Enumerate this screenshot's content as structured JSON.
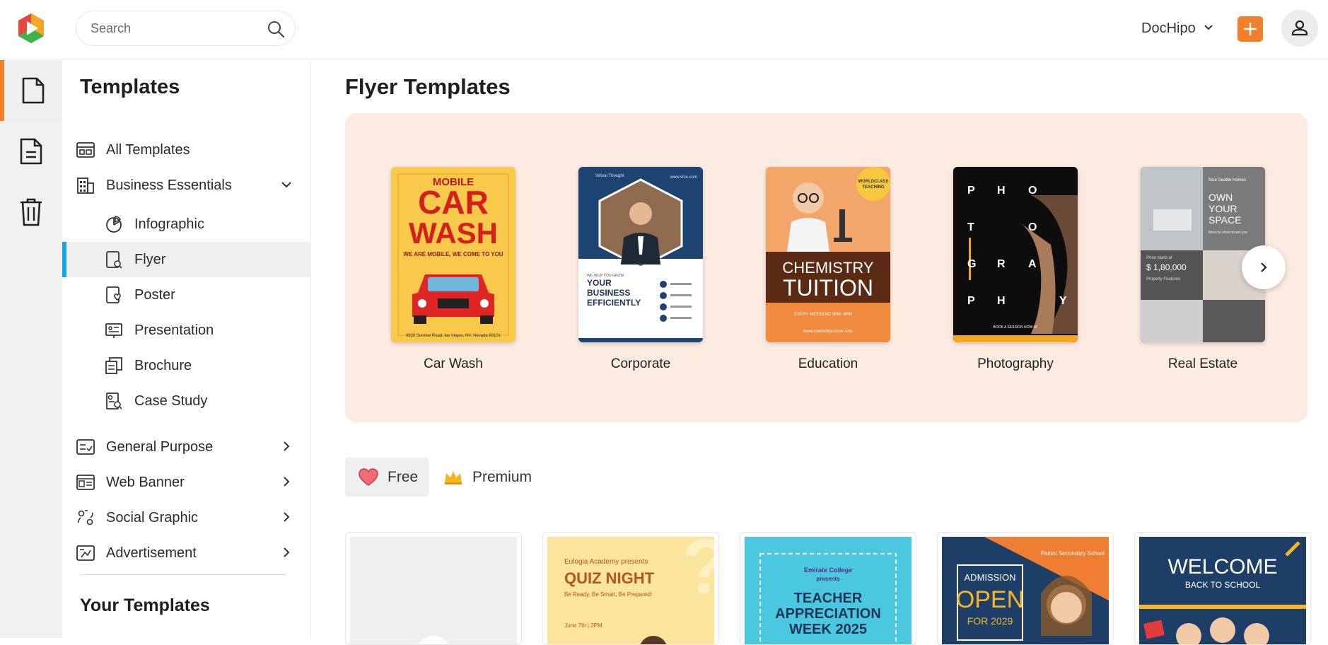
{
  "header": {
    "search_placeholder": "Search",
    "account_name": "DocHipo",
    "brand_color": "#f27f2c"
  },
  "rail": {
    "items": [
      {
        "icon": "document-icon",
        "active": true
      },
      {
        "icon": "file-text-icon",
        "active": false
      },
      {
        "icon": "trash-icon",
        "active": false
      }
    ]
  },
  "sidebar": {
    "title": "Templates",
    "items": [
      {
        "label": "All Templates",
        "icon": "layout-icon"
      },
      {
        "label": "Business Essentials",
        "icon": "building-icon",
        "expanded": true
      },
      {
        "label": "Infographic",
        "icon": "pie-chart-icon"
      },
      {
        "label": "Flyer",
        "icon": "flyer-icon",
        "active": true
      },
      {
        "label": "Poster",
        "icon": "poster-icon"
      },
      {
        "label": "Presentation",
        "icon": "presentation-icon"
      },
      {
        "label": "Brochure",
        "icon": "brochure-icon"
      },
      {
        "label": "Case Study",
        "icon": "case-study-icon"
      },
      {
        "label": "General Purpose",
        "icon": "checklist-icon"
      },
      {
        "label": "Web Banner",
        "icon": "web-banner-icon"
      },
      {
        "label": "Social Graphic",
        "icon": "social-icon"
      },
      {
        "label": "Advertisement",
        "icon": "advertisement-icon"
      }
    ],
    "your_templates": "Your Templates",
    "active_color": "#1aa6e6"
  },
  "main": {
    "title": "Flyer Templates",
    "categories": [
      {
        "label": "Car Wash"
      },
      {
        "label": "Corporate"
      },
      {
        "label": "Education"
      },
      {
        "label": "Photography"
      },
      {
        "label": "Real Estate"
      }
    ],
    "tabs": [
      {
        "label": "Free",
        "icon": "heart-icon",
        "active": true
      },
      {
        "label": "Premium",
        "icon": "crown-icon",
        "active": false
      }
    ]
  },
  "thumbs": {
    "carwash": {
      "top": "MOBILE",
      "big1": "CAR",
      "big2": "WASH",
      "tag": "WE ARE MOBILE, WE COME TO YOU",
      "addr": "4820 Sunrise Road, las Vegas, NV, Nevada 89101"
    },
    "corporate": {
      "brand": "Virtual Thought",
      "site": "www.vtce.com",
      "small": "WE HELP YOU GROW",
      "head1": "YOUR",
      "head2": "BUSINESS",
      "head3": "EFFICIENTLY"
    },
    "education": {
      "badge1": "WORLDCLASS",
      "badge2": "TEACHING",
      "t1": "CHEMISTRY",
      "t2": "TUITION",
      "line": "EVERY WEEKEND 5PM -9PM",
      "site": "www.chemistrycorner.com"
    },
    "photo": {
      "letters": [
        "P",
        "H",
        "O",
        "T",
        "O",
        "G",
        "R",
        "A",
        "P",
        "H",
        "Y"
      ],
      "foot": "BOOK A SESSION NOW AT"
    },
    "realestate": {
      "brand": "Nice Seattle Homes",
      "h1": "OWN",
      "h2": "YOUR",
      "h3": "SPACE",
      "sub": "Move to what moves you",
      "price_label": "Price starts at",
      "price": "$ 1,80,000",
      "features": "Property Features"
    }
  },
  "cards": [
    {
      "blank": true
    },
    {
      "org": "Eulogia Academy presents",
      "title": "QUIZ NIGHT",
      "sub": "Be Ready, Be Smart, Be Prepared!",
      "date": "June 7th | 2PM"
    },
    {
      "org": "Emirate College",
      "presents": "presents",
      "t1": "TEACHER",
      "t2": "APPRECIATION",
      "t3": "WEEK 2025"
    },
    {
      "school": "Patriot Secondary School",
      "a1": "ADMISSION",
      "a2": "OPEN",
      "a3": "FOR 2029"
    },
    {
      "w1": "WELCOME",
      "w2": "BACK TO SCHOOL"
    }
  ]
}
